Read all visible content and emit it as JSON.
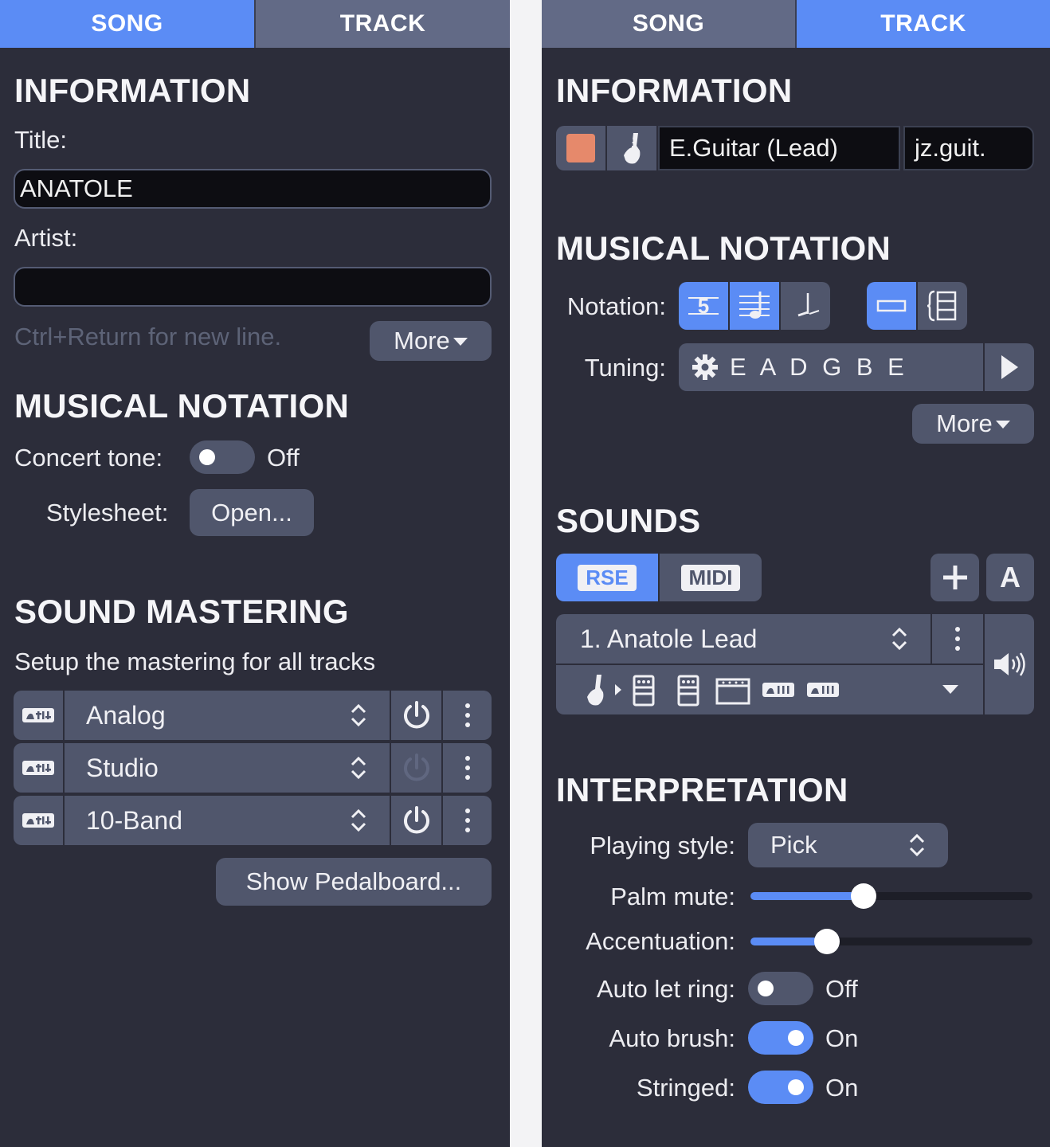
{
  "left_panel": {
    "tabs": {
      "song": "SONG",
      "track": "TRACK",
      "active": "song"
    },
    "information": {
      "heading": "INFORMATION",
      "title_label": "Title:",
      "title_value": "ANATOLE",
      "artist_label": "Artist:",
      "artist_value": "",
      "hint": "Ctrl+Return for new line.",
      "more_label": "More"
    },
    "musical_notation": {
      "heading": "MUSICAL NOTATION",
      "concert_tone_label": "Concert tone:",
      "concert_tone_state": "Off",
      "stylesheet_label": "Stylesheet:",
      "stylesheet_button": "Open..."
    },
    "sound_mastering": {
      "heading": "SOUND MASTERING",
      "description": "Setup the mastering for all tracks",
      "rows": [
        {
          "name": "Analog",
          "enabled": true
        },
        {
          "name": "Studio",
          "enabled": false
        },
        {
          "name": "10-Band",
          "enabled": true
        }
      ],
      "pedalboard_button": "Show Pedalboard..."
    }
  },
  "right_panel": {
    "tabs": {
      "song": "SONG",
      "track": "TRACK",
      "active": "track"
    },
    "information": {
      "heading": "INFORMATION",
      "track_color": "#e6896b",
      "instrument_icon": "electric-guitar-icon",
      "track_name": "E.Guitar (Lead)",
      "track_short_name": "jz.guit."
    },
    "musical_notation": {
      "heading": "MUSICAL NOTATION",
      "notation_label": "Notation:",
      "tablature_digit": "5",
      "tuning_label": "Tuning:",
      "tuning_value": "E A D G B E",
      "more_label": "More"
    },
    "sounds": {
      "heading": "SOUNDS",
      "rse_label": "RSE",
      "midi_label": "MIDI",
      "add_icon": "plus-icon",
      "auto_label": "A",
      "sound_name": "1. Anatole Lead"
    },
    "interpretation": {
      "heading": "INTERPRETATION",
      "playing_style_label": "Playing style:",
      "playing_style_value": "Pick",
      "palm_mute_label": "Palm mute:",
      "palm_mute_level": 0.4,
      "accentuation_label": "Accentuation:",
      "accentuation_level": 0.27,
      "auto_let_ring_label": "Auto let ring:",
      "auto_let_ring_state": "Off",
      "auto_brush_label": "Auto brush:",
      "auto_brush_state": "On",
      "stringed_label": "Stringed:",
      "stringed_state": "On"
    }
  },
  "colors": {
    "accent": "#5b8cf5",
    "panel_bg": "#2c2d3a",
    "control_bg": "#50566c",
    "field_bg": "#0d0d12"
  }
}
